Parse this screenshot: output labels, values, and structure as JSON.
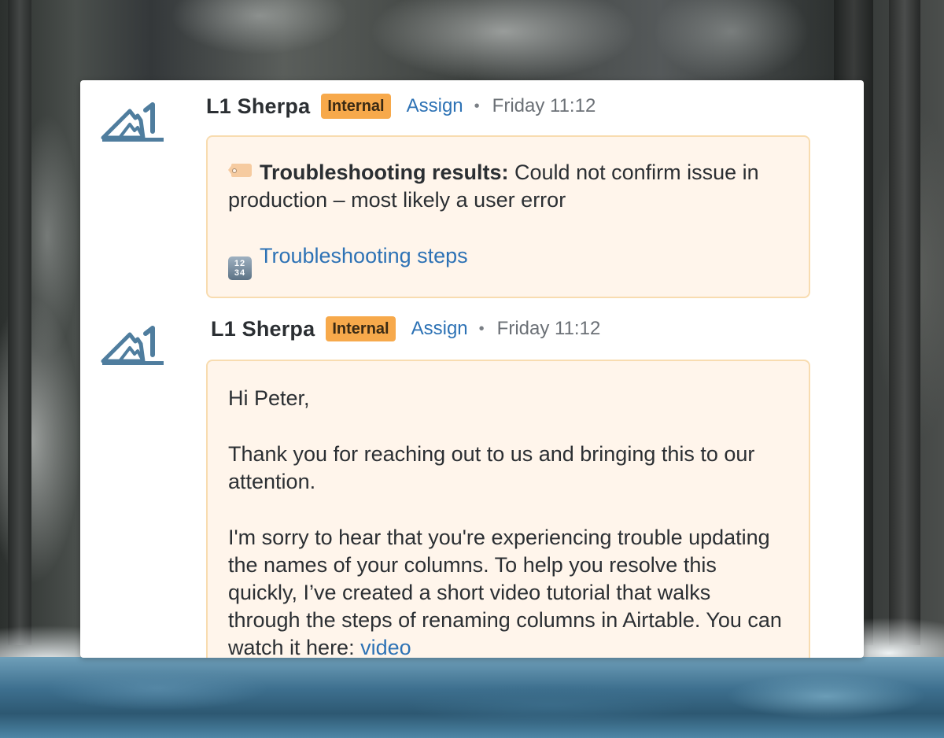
{
  "messages": [
    {
      "sender": "L1 Sherpa",
      "badge": "Internal",
      "assign_label": "Assign",
      "separator": "•",
      "timestamp": "Friday 11:12",
      "results_label": "Troubleshooting results:",
      "results_text": "Could not confirm issue in production – most likely a user error",
      "steps_icon_top": "12",
      "steps_icon_bottom": "34",
      "steps_link": "Troubleshooting steps"
    },
    {
      "sender": "L1 Sherpa",
      "badge": "Internal",
      "assign_label": "Assign",
      "separator": "•",
      "timestamp": "Friday 11:12",
      "greeting": "Hi Peter,",
      "para1": "Thank you for reaching out to us and bringing this to our attention.",
      "para2": "I'm sorry to hear that you're experiencing trouble updating the names of your columns. To help you resolve this quickly, I’ve created a short video tutorial that walks through the steps of renaming columns in Airtable. You can watch it here:",
      "video_link": "video"
    }
  ],
  "colors": {
    "badge": "#f7a94b",
    "link": "#2d72b5",
    "bubble_bg": "#fff5eb",
    "bubble_border": "#f8dcb0",
    "logo": "#4f7d9e"
  },
  "icons": {
    "avatar": "mountain-logo-icon",
    "results": "tag-label-icon",
    "steps": "input-numbers-icon"
  }
}
